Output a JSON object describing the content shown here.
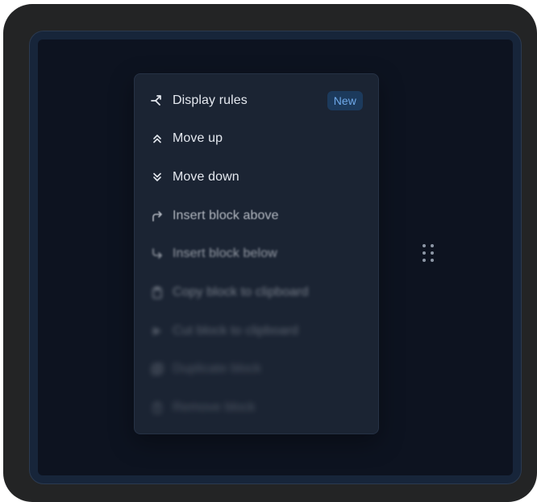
{
  "menu": {
    "items": [
      {
        "label": "Display rules",
        "icon": "branch-icon",
        "badge": "New"
      },
      {
        "label": "Move up",
        "icon": "chevrons-up-icon"
      },
      {
        "label": "Move down",
        "icon": "chevrons-down-icon"
      },
      {
        "label": "Insert block above",
        "icon": "arrow-corner-up-right-icon"
      },
      {
        "label": "Insert block below",
        "icon": "arrow-corner-down-right-icon"
      },
      {
        "label": "Copy block to clipboard",
        "icon": "clipboard-icon"
      },
      {
        "label": "Cut block to clipboard",
        "icon": "scissors-icon"
      },
      {
        "label": "Duplicate block",
        "icon": "copy-icon"
      },
      {
        "label": "Remove block",
        "icon": "trash-icon"
      }
    ]
  },
  "colors": {
    "frame": "#232425",
    "canvas": "#0d1320",
    "menu_bg": "#1b2433",
    "text": "#e4e8ef",
    "badge_bg": "#1c3a5c",
    "badge_text": "#6fa9ea"
  }
}
